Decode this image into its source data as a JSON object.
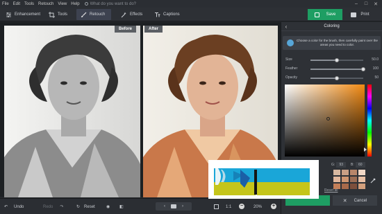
{
  "menu": {
    "items": [
      "File",
      "Edit",
      "Tools",
      "Retouch",
      "View",
      "Help"
    ],
    "search_placeholder": "What do you want to do?"
  },
  "toolbar": {
    "tabs": [
      {
        "label": "Enhancement",
        "icon": "sliders-icon"
      },
      {
        "label": "Tools",
        "icon": "crop-icon"
      },
      {
        "label": "Retouch",
        "icon": "brush-icon",
        "active": true
      },
      {
        "label": "Effects",
        "icon": "magic-wand-icon"
      },
      {
        "label": "Captions",
        "icon": "text-icon"
      }
    ],
    "save_label": "Save",
    "print_label": "Print"
  },
  "canvas": {
    "before_label": "Before",
    "after_label": "After"
  },
  "bottombar": {
    "undo_label": "Undo",
    "redo_label": "Redo",
    "reset_label": "Reset",
    "zoom_fit_label": "1:1",
    "zoom_value": "20%"
  },
  "panel": {
    "title": "Coloring",
    "hint": "Choose a color for the brush, then carefully paint over the areas you need to color.",
    "size": {
      "label": "Size",
      "value": "50.0",
      "fraction": 0.5
    },
    "feather": {
      "label": "Feather",
      "value": "100",
      "fraction": 1.0
    },
    "opacity": {
      "label": "Opacity",
      "value": "50",
      "fraction": 0.5
    },
    "rgb": {
      "r_label": "R:",
      "r": "",
      "g_label": "G:",
      "g": "93",
      "b_label": "B:",
      "b": "60"
    },
    "swatches": [
      "#d8b8a0",
      "#c9a085",
      "#b8866a",
      "#f1d8c6",
      "#e2b79c",
      "#cf9670",
      "#9d6e55",
      "#e8c0a5",
      "#c47f58",
      "#a86a4a",
      "#7d4f3c",
      "#d4a07d"
    ],
    "reset_all_label": "Reset all",
    "cancel_label": "Cancel"
  },
  "colors": {
    "accent_green": "#1e9e63",
    "active_tab": "#3d4250",
    "picker_hue": "#f28a12",
    "overlay_blue": "#1aa6d8",
    "overlay_yellow": "#c5c51a"
  }
}
